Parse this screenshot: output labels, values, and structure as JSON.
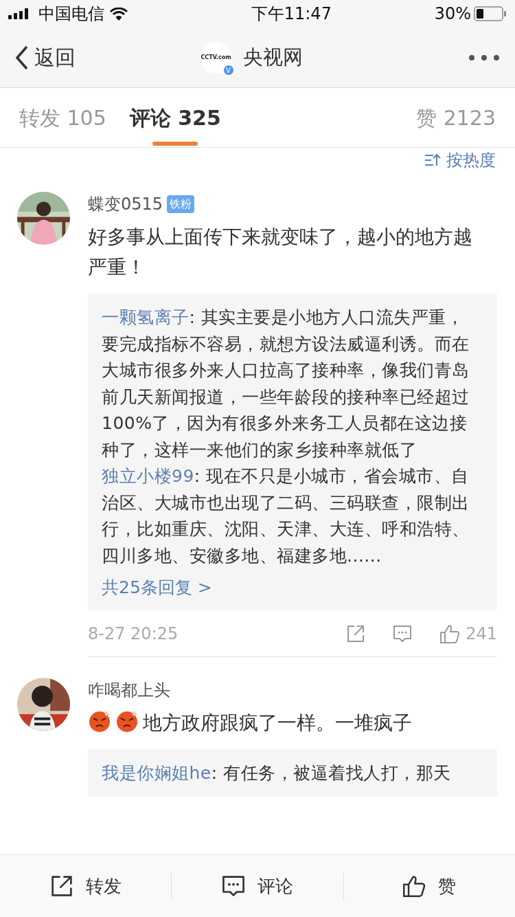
{
  "status_bar": {
    "carrier": "中国电信",
    "time": "下午11:47",
    "battery_text": "30%"
  },
  "nav": {
    "back": "返回",
    "logo_text": "CCTV.com",
    "verified_mark": "V",
    "title": "央视网"
  },
  "tabs": [
    {
      "label": "转发 105",
      "selected": false
    },
    {
      "label": "评论 325",
      "selected": true
    },
    {
      "label": "赞 2123",
      "selected": false
    }
  ],
  "sort": {
    "label": "按热度"
  },
  "comments": [
    {
      "user": "蝶变0515",
      "badge": "铁粉",
      "emoji_prefix": false,
      "text": "好多事从上面传下来就变味了，越小的地方越严重！",
      "replies": [
        {
          "user": "一颗氢离子",
          "text": ": 其实主要是小地方人口流失严重，要完成指标不容易，就想方设法威逼利诱。而在大城市很多外来人口拉高了接种率，像我们青岛前几天新闻报道，一些年龄段的接种率已经超过100%了，因为有很多外来务工人员都在这边接种了，这样一来他们的家乡接种率就低了"
        },
        {
          "user": "独立小楼99",
          "text": ": 现在不只是小城市，省会城市、自治区、大城市也出现了二码、三码联查，限制出行，比如重庆、沈阳、天津、大连、呼和浩特、四川多地、安徽多地、福建多地......"
        }
      ],
      "more": "共25条回复 >",
      "time": "8-27 20:25",
      "likes": "241"
    },
    {
      "user": "咋喝都上头",
      "emoji_prefix": true,
      "text": "地方政府跟疯了一样。一堆疯子",
      "replies": [
        {
          "user": "我是你娴姐he",
          "text": ": 有任务，被逼着找人打，那天"
        }
      ]
    }
  ],
  "bottom_bar": [
    {
      "label": "转发",
      "kind": "share"
    },
    {
      "label": "评论",
      "kind": "comment"
    },
    {
      "label": "赞",
      "kind": "like"
    }
  ]
}
